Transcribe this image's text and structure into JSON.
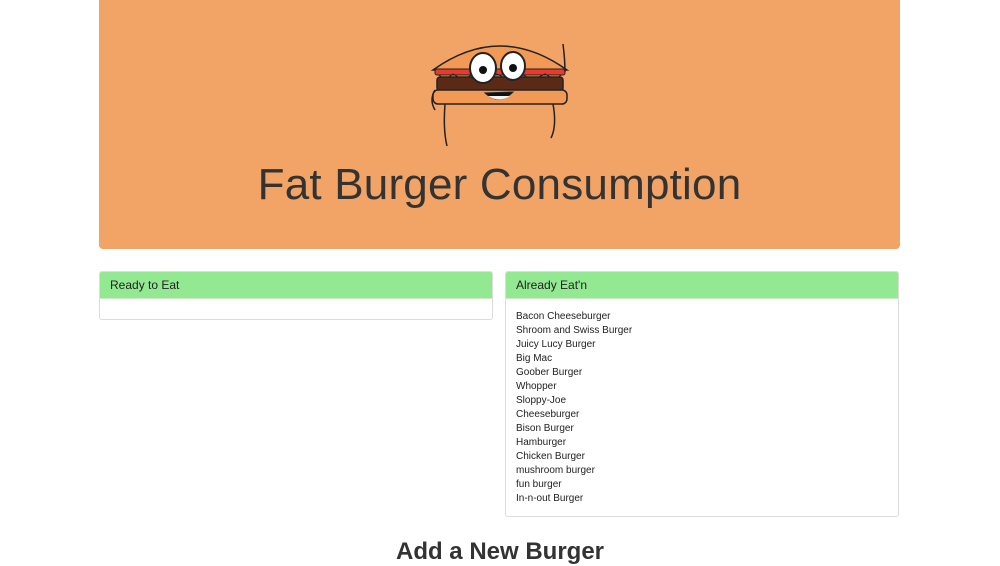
{
  "colors": {
    "hero_bg": "#f2a466",
    "panel_heading_bg": "#93e992"
  },
  "hero": {
    "mascot_icon": "burger-mascot-icon",
    "title": "Fat Burger Consumption"
  },
  "ready_panel": {
    "heading": "Ready to Eat",
    "items": []
  },
  "eaten_panel": {
    "heading": "Already Eat'n",
    "items": [
      "Bacon Cheeseburger",
      "Shroom and Swiss Burger",
      "Juicy Lucy Burger",
      "Big Mac",
      "Goober Burger",
      "Whopper",
      "Sloppy-Joe",
      "Cheeseburger",
      "Bison Burger",
      "Hamburger",
      "Chicken Burger",
      "mushroom burger",
      "fun burger",
      "In-n-out Burger"
    ]
  },
  "add_section": {
    "title": "Add a New Burger"
  }
}
